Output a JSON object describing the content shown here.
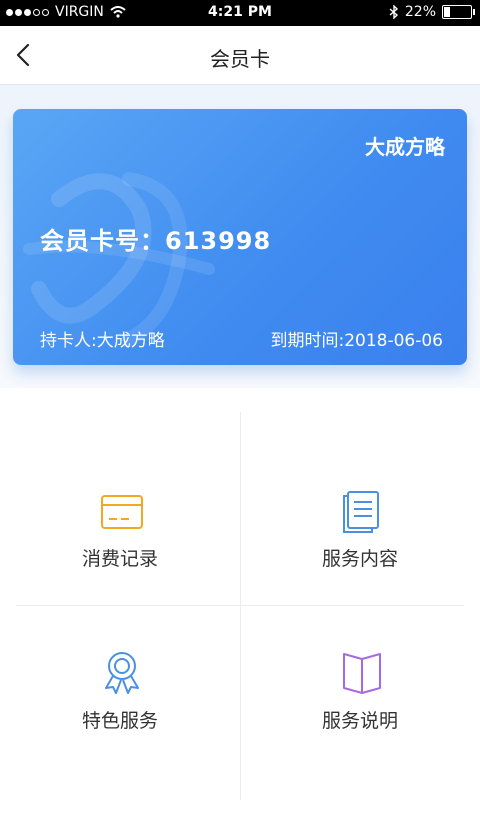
{
  "status_bar": {
    "carrier": "VIRGIN",
    "time": "4:21 PM",
    "battery": "22%",
    "battery_level": 0.22
  },
  "nav": {
    "title": "会员卡"
  },
  "card": {
    "brand": "大成方略",
    "number_label": "会员卡号：613998",
    "holder": "持卡人:大成方略",
    "expiry": "到期时间:2018-06-06"
  },
  "menu": [
    {
      "label": "消费记录",
      "icon": "card-icon",
      "color": "#f5a623"
    },
    {
      "label": "服务内容",
      "icon": "document-icon",
      "color": "#4a90e2"
    },
    {
      "label": "特色服务",
      "icon": "award-badge-icon",
      "color": "#4a90e2"
    },
    {
      "label": "服务说明",
      "icon": "book-icon",
      "color": "#a56ae0"
    }
  ]
}
